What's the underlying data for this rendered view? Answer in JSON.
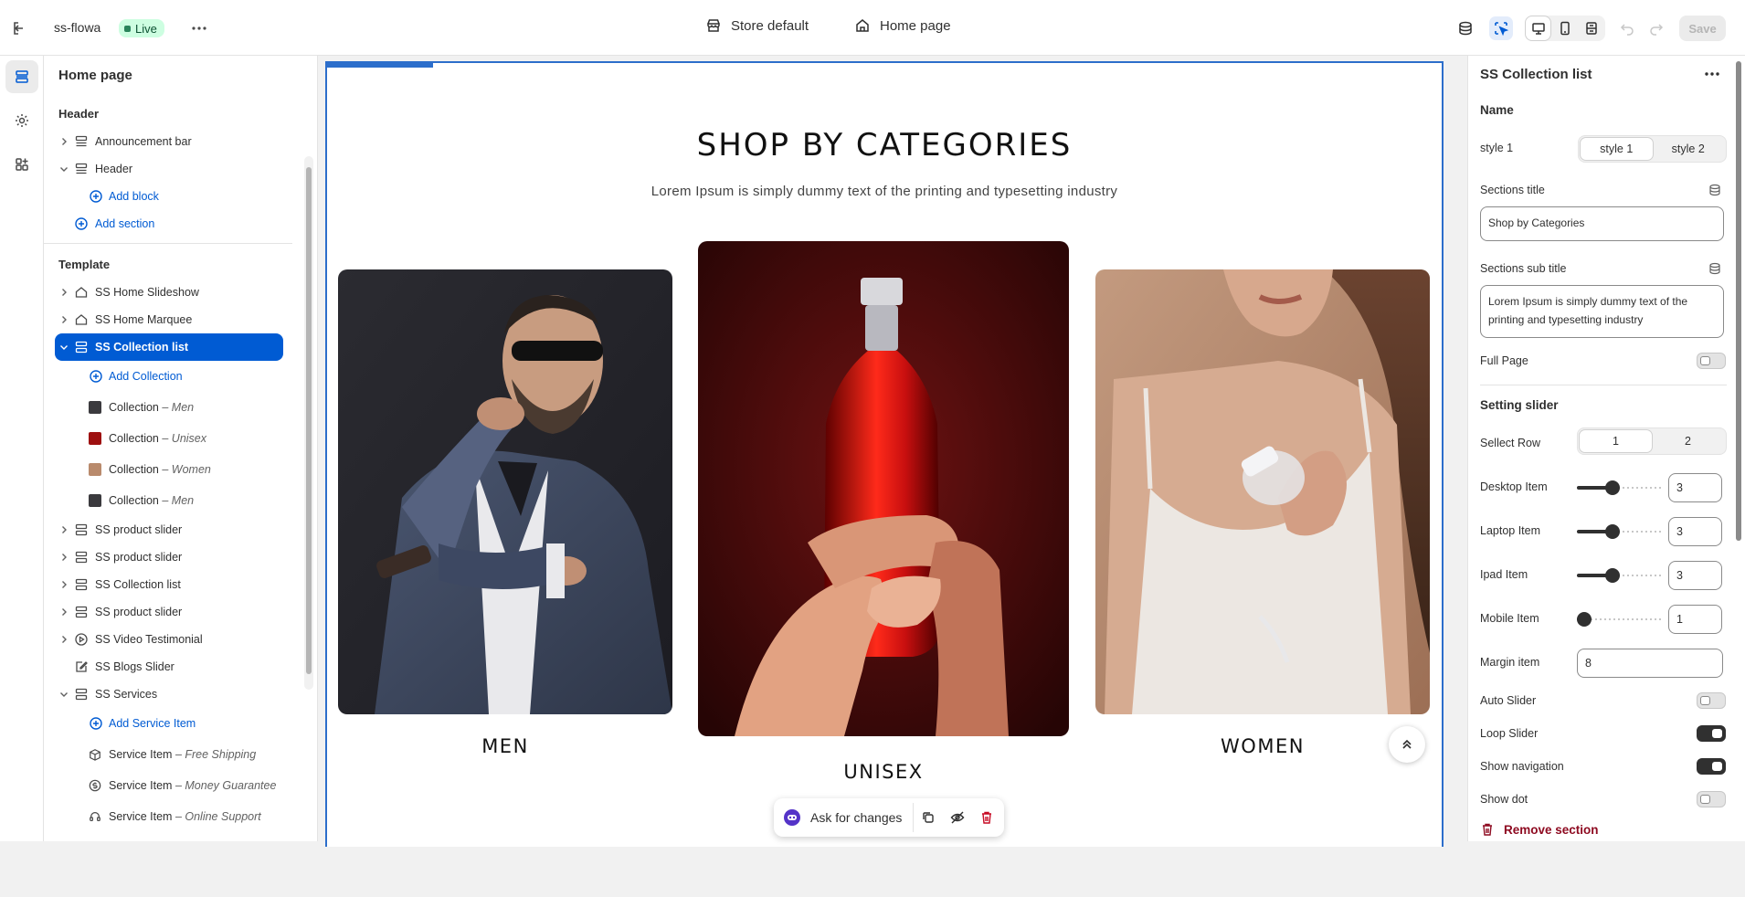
{
  "topbar": {
    "store_name": "ss-flowa",
    "status_badge": "Live",
    "theme_label": "Store default",
    "page_label": "Home page",
    "save_label": "Save"
  },
  "left_panel": {
    "title": "Home page",
    "header_group": "Header",
    "header_items": [
      {
        "label": "Announcement bar"
      },
      {
        "label": "Header"
      }
    ],
    "add_block": "Add block",
    "add_section": "Add section",
    "template_group": "Template",
    "template_items": [
      {
        "label": "SS Home Slideshow"
      },
      {
        "label": "SS Home Marquee"
      },
      {
        "label": "SS Collection list"
      }
    ],
    "add_collection": "Add Collection",
    "collection_blocks": [
      {
        "label": "Collection",
        "sub": "– Men"
      },
      {
        "label": "Collection",
        "sub": "– Unisex"
      },
      {
        "label": "Collection",
        "sub": "– Women"
      },
      {
        "label": "Collection",
        "sub": "– Men"
      }
    ],
    "more_items": [
      {
        "label": "SS product slider"
      },
      {
        "label": "SS product slider"
      },
      {
        "label": "SS Collection list"
      },
      {
        "label": "SS product slider"
      },
      {
        "label": "SS Video Testimonial"
      },
      {
        "label": "SS Blogs Slider"
      },
      {
        "label": "SS Services"
      }
    ],
    "add_service_item": "Add Service Item",
    "service_items": [
      {
        "label": "Service Item",
        "sub": "– Free Shipping"
      },
      {
        "label": "Service Item",
        "sub": "– Money Guarantee"
      },
      {
        "label": "Service Item",
        "sub": "– Online Support"
      }
    ]
  },
  "preview": {
    "title": "SHOP BY CATEGORIES",
    "subtitle": "Lorem Ipsum is simply dummy text of the printing and typesetting industry",
    "categories": [
      {
        "label": "MEN"
      },
      {
        "label": "UNISEX"
      },
      {
        "label": "WOMEN"
      }
    ],
    "ask_for_changes": "Ask for changes"
  },
  "right_panel": {
    "title": "SS Collection list",
    "name_heading": "Name",
    "style_label": "style 1",
    "style_options": [
      "style 1",
      "style 2"
    ],
    "style_selected": "style 1",
    "sections_title_label": "Sections title",
    "sections_title_value": "Shop by Categories",
    "sections_subtitle_label": "Sections sub title",
    "sections_subtitle_value": "Lorem Ipsum is simply dummy text of the printing and typesetting industry",
    "full_page_label": "Full Page",
    "full_page_on": false,
    "slider_heading": "Setting slider",
    "select_row_label": "Sellect Row",
    "row_options": [
      "1",
      "2"
    ],
    "row_selected": "1",
    "range_items": [
      {
        "label": "Desktop Item",
        "value": "3"
      },
      {
        "label": "Laptop Item",
        "value": "3"
      },
      {
        "label": "Ipad Item",
        "value": "3"
      },
      {
        "label": "Mobile Item",
        "value": "1"
      }
    ],
    "margin_label": "Margin item",
    "margin_value": "8",
    "toggles": [
      {
        "label": "Auto Slider",
        "on": false
      },
      {
        "label": "Loop Slider",
        "on": true
      },
      {
        "label": "Show navigation",
        "on": true
      },
      {
        "label": "Show dot",
        "on": false
      }
    ],
    "remove_section": "Remove section"
  },
  "colors": {
    "accent": "#005bd3",
    "live_badge_bg": "#cdfee1",
    "danger": "#8e0b21"
  }
}
